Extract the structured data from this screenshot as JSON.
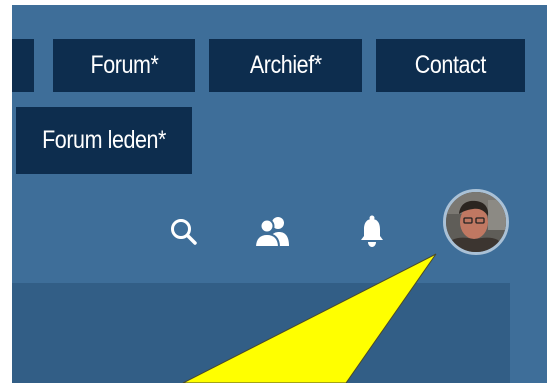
{
  "nav": {
    "items": [
      {
        "label": ""
      },
      {
        "label": "Forum*"
      },
      {
        "label": "Archief*"
      },
      {
        "label": "Contact"
      }
    ],
    "second_row": {
      "label": "Forum leden*"
    }
  },
  "toolbar": {
    "icons": [
      "search-icon",
      "members-icon",
      "notifications-bell-icon",
      "user-avatar"
    ]
  },
  "colors": {
    "header_bg": "#3e6e99",
    "nav_button_bg": "#0d2d4e",
    "nav_text": "#ffffff",
    "content_panel": "#325e86",
    "annotation_arrow": "#ffff00"
  }
}
